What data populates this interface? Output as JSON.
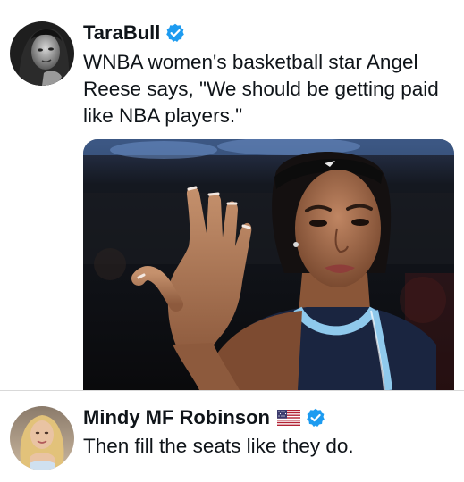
{
  "posts": [
    {
      "author": {
        "display_name": "TaraBull",
        "verified": true
      },
      "text": "WNBA women's basketball star Angel Reese says, \"We should be getting paid like NBA players.\"",
      "has_media": true
    },
    {
      "author": {
        "display_name": "Mindy MF Robinson",
        "verified": true,
        "flag_emoji": "us-flag"
      },
      "text": "Then fill the seats like they do."
    }
  ],
  "colors": {
    "verified_blue": "#1d9bf0",
    "text_primary": "#0f1419",
    "divider": "#d9d9d9",
    "jersey_navy": "#1a2540",
    "jersey_sky": "#8fc9ec"
  }
}
